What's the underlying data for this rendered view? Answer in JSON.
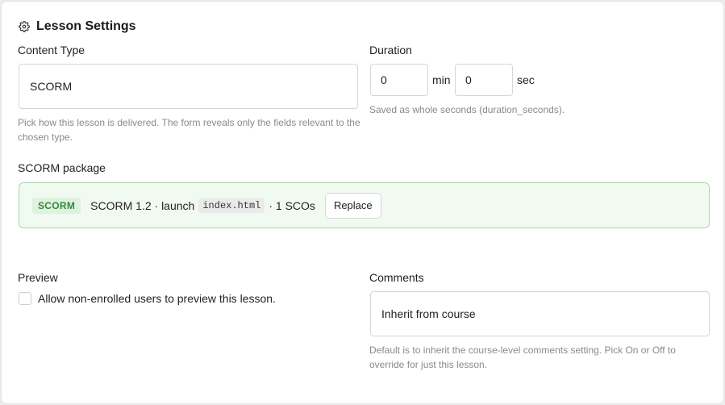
{
  "header": {
    "title": "Lesson Settings",
    "icon": "gear-icon"
  },
  "content_type": {
    "label": "Content Type",
    "value": "SCORM",
    "help": "Pick how this lesson is delivered. The form reveals only the fields relevant to the chosen type."
  },
  "duration": {
    "label": "Duration",
    "minutes_value": "0",
    "minutes_unit": "min",
    "seconds_value": "0",
    "seconds_unit": "sec",
    "help": "Saved as whole seconds (duration_seconds)."
  },
  "scorm_package": {
    "label": "SCORM package",
    "badge": "SCORM",
    "version_text": "SCORM 1.2 · launch",
    "launch_file": "index.html",
    "sco_text": "· 1 SCOs",
    "replace_label": "Replace",
    "accent_color": "#2f8a3a",
    "background_color": "#f1faf1"
  },
  "preview": {
    "label": "Preview",
    "checkbox_label": "Allow non-enrolled users to preview this lesson.",
    "checked": false
  },
  "comments": {
    "label": "Comments",
    "value": "Inherit from course",
    "help": "Default is to inherit the course-level comments setting. Pick On or Off to override for just this lesson."
  }
}
